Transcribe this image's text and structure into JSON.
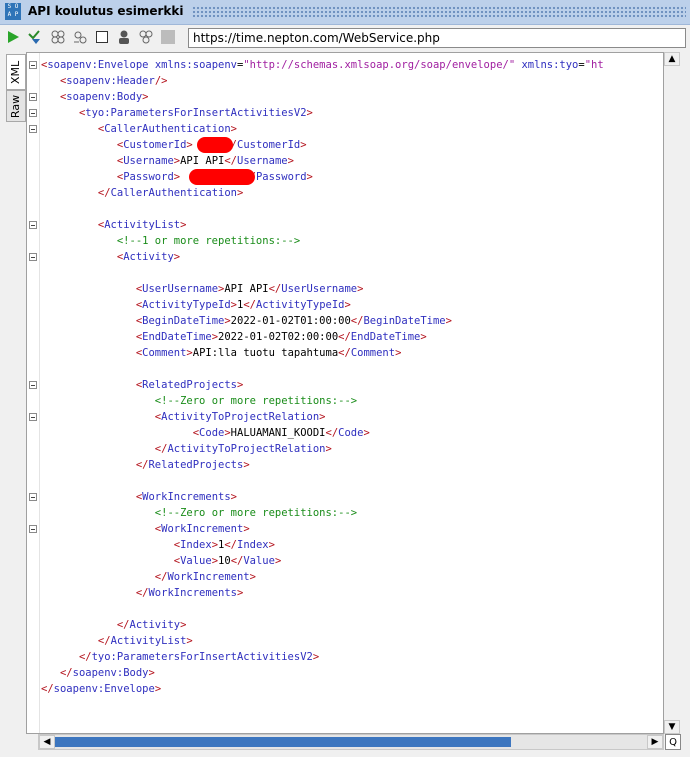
{
  "window": {
    "title": "API koulutus esimerkki",
    "logo_text": "SOAP"
  },
  "toolbar": {
    "buttons": [
      "run-icon",
      "submit-icon",
      "stop-icon",
      "add-icon",
      "checkbox-icon",
      "user-icon",
      "attachment-icon",
      "options-icon"
    ],
    "url": "https://time.nepton.com/WebService.php"
  },
  "side_tabs": {
    "xml": "XML",
    "raw": "Raw"
  },
  "code_lines": [
    [
      [
        "t",
        "<"
      ],
      [
        "n",
        "soapenv:Envelope"
      ],
      [
        "x",
        " "
      ],
      [
        "a",
        "xmlns:soapenv"
      ],
      [
        "x",
        "="
      ],
      [
        "v",
        "\"http://schemas.xmlsoap.org/soap/envelope/\""
      ],
      [
        "x",
        " "
      ],
      [
        "a",
        "xmlns:tyo"
      ],
      [
        "x",
        "="
      ],
      [
        "v",
        "\"ht"
      ]
    ],
    [
      [
        "x",
        "   "
      ],
      [
        "t",
        "<"
      ],
      [
        "n",
        "soapenv:Header"
      ],
      [
        "t",
        "/>"
      ]
    ],
    [
      [
        "x",
        "   "
      ],
      [
        "t",
        "<"
      ],
      [
        "n",
        "soapenv:Body"
      ],
      [
        "t",
        ">"
      ]
    ],
    [
      [
        "x",
        "      "
      ],
      [
        "t",
        "<"
      ],
      [
        "n",
        "tyo:ParametersForInsertActivitiesV2"
      ],
      [
        "t",
        ">"
      ]
    ],
    [
      [
        "x",
        "         "
      ],
      [
        "t",
        "<"
      ],
      [
        "n",
        "CallerAuthentication"
      ],
      [
        "t",
        ">"
      ]
    ],
    [
      [
        "x",
        "            "
      ],
      [
        "t",
        "<"
      ],
      [
        "n",
        "CustomerId"
      ],
      [
        "t",
        ">"
      ],
      [
        "x",
        "     "
      ],
      [
        "t",
        "</"
      ],
      [
        "n",
        "CustomerId"
      ],
      [
        "t",
        ">"
      ]
    ],
    [
      [
        "x",
        "            "
      ],
      [
        "t",
        "<"
      ],
      [
        "n",
        "Username"
      ],
      [
        "t",
        ">"
      ],
      [
        "x",
        "API API"
      ],
      [
        "t",
        "</"
      ],
      [
        "n",
        "Username"
      ],
      [
        "t",
        ">"
      ]
    ],
    [
      [
        "x",
        "            "
      ],
      [
        "t",
        "<"
      ],
      [
        "n",
        "Password"
      ],
      [
        "t",
        ">"
      ],
      [
        "x",
        "          "
      ],
      [
        "t",
        "</"
      ],
      [
        "n",
        "Password"
      ],
      [
        "t",
        ">"
      ]
    ],
    [
      [
        "x",
        "         "
      ],
      [
        "t",
        "</"
      ],
      [
        "n",
        "CallerAuthentication"
      ],
      [
        "t",
        ">"
      ]
    ],
    [],
    [
      [
        "x",
        "         "
      ],
      [
        "t",
        "<"
      ],
      [
        "n",
        "ActivityList"
      ],
      [
        "t",
        ">"
      ]
    ],
    [
      [
        "x",
        "            "
      ],
      [
        "c",
        "<!--1 or more repetitions:-->"
      ]
    ],
    [
      [
        "x",
        "            "
      ],
      [
        "t",
        "<"
      ],
      [
        "n",
        "Activity"
      ],
      [
        "t",
        ">"
      ]
    ],
    [],
    [
      [
        "x",
        "               "
      ],
      [
        "t",
        "<"
      ],
      [
        "n",
        "UserUsername"
      ],
      [
        "t",
        ">"
      ],
      [
        "x",
        "API API"
      ],
      [
        "t",
        "</"
      ],
      [
        "n",
        "UserUsername"
      ],
      [
        "t",
        ">"
      ]
    ],
    [
      [
        "x",
        "               "
      ],
      [
        "t",
        "<"
      ],
      [
        "n",
        "ActivityTypeId"
      ],
      [
        "t",
        ">"
      ],
      [
        "x",
        "1"
      ],
      [
        "t",
        "</"
      ],
      [
        "n",
        "ActivityTypeId"
      ],
      [
        "t",
        ">"
      ]
    ],
    [
      [
        "x",
        "               "
      ],
      [
        "t",
        "<"
      ],
      [
        "n",
        "BeginDateTime"
      ],
      [
        "t",
        ">"
      ],
      [
        "x",
        "2022-01-02T01:00:00"
      ],
      [
        "t",
        "</"
      ],
      [
        "n",
        "BeginDateTime"
      ],
      [
        "t",
        ">"
      ]
    ],
    [
      [
        "x",
        "               "
      ],
      [
        "t",
        "<"
      ],
      [
        "n",
        "EndDateTime"
      ],
      [
        "t",
        ">"
      ],
      [
        "x",
        "2022-01-02T02:00:00"
      ],
      [
        "t",
        "</"
      ],
      [
        "n",
        "EndDateTime"
      ],
      [
        "t",
        ">"
      ]
    ],
    [
      [
        "x",
        "               "
      ],
      [
        "t",
        "<"
      ],
      [
        "n",
        "Comment"
      ],
      [
        "t",
        ">"
      ],
      [
        "x",
        "API:lla tuotu tapahtuma"
      ],
      [
        "t",
        "</"
      ],
      [
        "n",
        "Comment"
      ],
      [
        "t",
        ">"
      ]
    ],
    [],
    [
      [
        "x",
        "               "
      ],
      [
        "t",
        "<"
      ],
      [
        "n",
        "RelatedProjects"
      ],
      [
        "t",
        ">"
      ]
    ],
    [
      [
        "x",
        "                  "
      ],
      [
        "c",
        "<!--Zero or more repetitions:-->"
      ]
    ],
    [
      [
        "x",
        "                  "
      ],
      [
        "t",
        "<"
      ],
      [
        "n",
        "ActivityToProjectRelation"
      ],
      [
        "t",
        ">"
      ]
    ],
    [
      [
        "x",
        "                        "
      ],
      [
        "t",
        "<"
      ],
      [
        "n",
        "Code"
      ],
      [
        "t",
        ">"
      ],
      [
        "x",
        "HALUAMANI_KOODI"
      ],
      [
        "t",
        "</"
      ],
      [
        "n",
        "Code"
      ],
      [
        "t",
        ">"
      ]
    ],
    [
      [
        "x",
        "                  "
      ],
      [
        "t",
        "</"
      ],
      [
        "n",
        "ActivityToProjectRelation"
      ],
      [
        "t",
        ">"
      ]
    ],
    [
      [
        "x",
        "               "
      ],
      [
        "t",
        "</"
      ],
      [
        "n",
        "RelatedProjects"
      ],
      [
        "t",
        ">"
      ]
    ],
    [],
    [
      [
        "x",
        "               "
      ],
      [
        "t",
        "<"
      ],
      [
        "n",
        "WorkIncrements"
      ],
      [
        "t",
        ">"
      ]
    ],
    [
      [
        "x",
        "                  "
      ],
      [
        "c",
        "<!--Zero or more repetitions:-->"
      ]
    ],
    [
      [
        "x",
        "                  "
      ],
      [
        "t",
        "<"
      ],
      [
        "n",
        "WorkIncrement"
      ],
      [
        "t",
        ">"
      ]
    ],
    [
      [
        "x",
        "                     "
      ],
      [
        "t",
        "<"
      ],
      [
        "n",
        "Index"
      ],
      [
        "t",
        ">"
      ],
      [
        "x",
        "1"
      ],
      [
        "t",
        "</"
      ],
      [
        "n",
        "Index"
      ],
      [
        "t",
        ">"
      ]
    ],
    [
      [
        "x",
        "                     "
      ],
      [
        "t",
        "<"
      ],
      [
        "n",
        "Value"
      ],
      [
        "t",
        ">"
      ],
      [
        "x",
        "10"
      ],
      [
        "t",
        "</"
      ],
      [
        "n",
        "Value"
      ],
      [
        "t",
        ">"
      ]
    ],
    [
      [
        "x",
        "                  "
      ],
      [
        "t",
        "</"
      ],
      [
        "n",
        "WorkIncrement"
      ],
      [
        "t",
        ">"
      ]
    ],
    [
      [
        "x",
        "               "
      ],
      [
        "t",
        "</"
      ],
      [
        "n",
        "WorkIncrements"
      ],
      [
        "t",
        ">"
      ]
    ],
    [],
    [
      [
        "x",
        "            "
      ],
      [
        "t",
        "</"
      ],
      [
        "n",
        "Activity"
      ],
      [
        "t",
        ">"
      ]
    ],
    [
      [
        "x",
        "         "
      ],
      [
        "t",
        "</"
      ],
      [
        "n",
        "ActivityList"
      ],
      [
        "t",
        ">"
      ]
    ],
    [
      [
        "x",
        "      "
      ],
      [
        "t",
        "</"
      ],
      [
        "n",
        "tyo:ParametersForInsertActivitiesV2"
      ],
      [
        "t",
        ">"
      ]
    ],
    [
      [
        "x",
        "   "
      ],
      [
        "t",
        "</"
      ],
      [
        "n",
        "soapenv:Body"
      ],
      [
        "t",
        ">"
      ]
    ],
    [
      [
        "t",
        "</"
      ],
      [
        "n",
        "soapenv:Envelope"
      ],
      [
        "t",
        ">"
      ]
    ]
  ],
  "fold_lines": [
    0,
    2,
    3,
    4,
    10,
    12,
    20,
    22,
    27,
    29
  ],
  "scrollbar": {
    "up": "▲",
    "down": "▼",
    "left": "◀",
    "right": "▶",
    "zoom": "Q"
  }
}
